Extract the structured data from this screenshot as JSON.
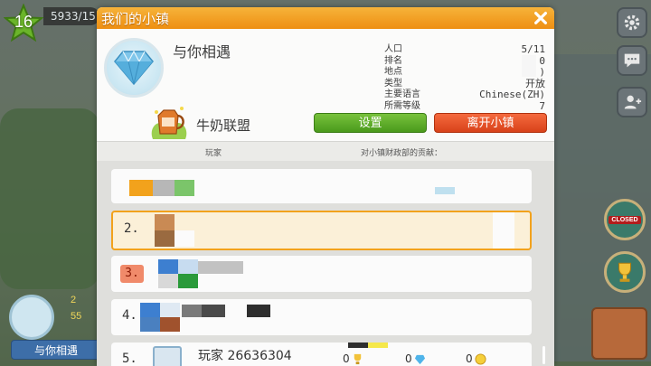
{
  "hud": {
    "level": "16",
    "xp_text": "5933/15",
    "town_badge_name": "与你相遇",
    "town_stat_1": "2",
    "town_stat_2": "55",
    "closed_sign": "CLOSED"
  },
  "dialog": {
    "title": "我们的小镇",
    "town_name": "与你相遇",
    "info": [
      {
        "label": "人口",
        "value": "5/11"
      },
      {
        "label": "排名",
        "value": "0"
      },
      {
        "label": "地点",
        "value": ")"
      },
      {
        "label": "类型",
        "value": "开放"
      },
      {
        "label": "主要语言",
        "value": "Chinese(ZH)"
      },
      {
        "label": "所需等级",
        "value": "7"
      }
    ],
    "alliance_name": "牛奶联盟",
    "settings_label": "设置",
    "leave_label": "离开小镇",
    "column_player": "玩家",
    "column_contribution": "对小镇财政部的贡献："
  },
  "rows": [
    {
      "rank": "",
      "name": ""
    },
    {
      "rank": "2.",
      "name": ""
    },
    {
      "rank": "3.",
      "name": ""
    },
    {
      "rank": "4.",
      "name": ""
    },
    {
      "rank": "5.",
      "name": "玩家 26636304",
      "stat_a": "0",
      "stat_b": "0",
      "stat_c": "0"
    }
  ],
  "colors": {
    "header_orange": "#ee8f12",
    "settings_green": "#4a9a1c",
    "leave_red": "#d8421a",
    "highlight_border": "#f2a21c"
  },
  "icons": [
    "close-icon",
    "gear-icon",
    "chat-icon",
    "add-friend-icon",
    "diamond-icon",
    "milk-jug-icon",
    "trophy-icon",
    "coin-icon",
    "gem-icon"
  ]
}
